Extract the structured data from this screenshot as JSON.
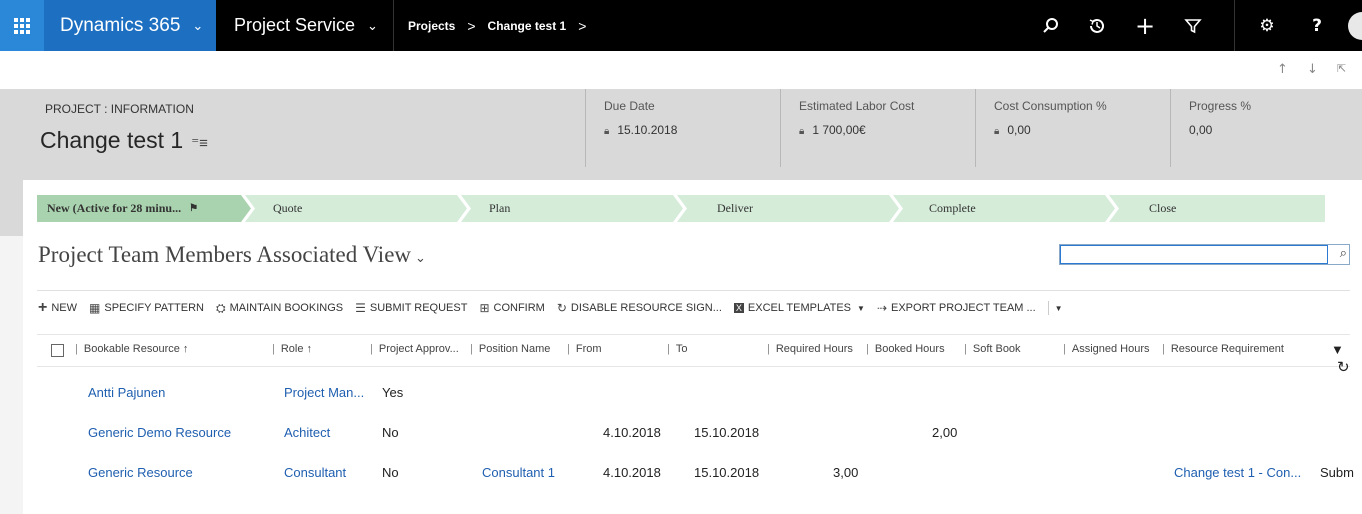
{
  "nav": {
    "app_name": "Dynamics 365",
    "area_name": "Project Service",
    "breadcrumbs": [
      "Projects",
      "Change test 1"
    ],
    "icons": [
      "search-icon",
      "history-icon",
      "add-icon",
      "filter-icon",
      "settings-icon",
      "help-icon"
    ]
  },
  "header": {
    "entity_label": "PROJECT : INFORMATION",
    "record_title": "Change test 1",
    "fields": [
      {
        "label": "Due Date",
        "value": "15.10.2018",
        "locked": true
      },
      {
        "label": "Estimated Labor Cost",
        "value": "1 700,00€",
        "locked": true
      },
      {
        "label": "Cost Consumption %",
        "value": "0,00",
        "locked": true
      },
      {
        "label": "Progress %",
        "value": "0,00",
        "locked": false
      }
    ]
  },
  "process": {
    "stages": [
      "New (Active for 28 minu...",
      "Quote",
      "Plan",
      "Deliver",
      "Complete",
      "Close"
    ],
    "active_color": "#a9d3ae",
    "stage_color": "#d5ecd9"
  },
  "view": {
    "title": "Project Team Members Associated View",
    "search_placeholder": ""
  },
  "commands": [
    {
      "label": "NEW",
      "icon": "+"
    },
    {
      "label": "SPECIFY PATTERN",
      "icon": "▦"
    },
    {
      "label": "MAINTAIN BOOKINGS",
      "icon": "⛭"
    },
    {
      "label": "SUBMIT REQUEST",
      "icon": "☰"
    },
    {
      "label": "CONFIRM",
      "icon": "⊞"
    },
    {
      "label": "DISABLE RESOURCE SIGN...",
      "icon": "↻"
    },
    {
      "label": "EXCEL TEMPLATES",
      "icon": "▣"
    },
    {
      "label": "EXPORT PROJECT TEAM ...",
      "icon": "⇢"
    }
  ],
  "columns": [
    "Bookable Resource ↑",
    "Role ↑",
    "Project Approv...",
    "Position Name",
    "From",
    "To",
    "Required Hours",
    "Booked Hours",
    "Soft Book",
    "Assigned Hours",
    "Resource Requirement"
  ],
  "rows": [
    {
      "resource": "Antti Pajunen",
      "role": "Project Man...",
      "approved": "Yes",
      "position": "",
      "from": "",
      "to": "",
      "required": "",
      "booked": "",
      "requirement": "",
      "extra": ""
    },
    {
      "resource": "Generic Demo Resource",
      "role": "Achitect",
      "approved": "No",
      "position": "",
      "from": "4.10.2018",
      "to": "15.10.2018",
      "required": "",
      "booked": "2,00",
      "requirement": "",
      "extra": ""
    },
    {
      "resource": "Generic Resource",
      "role": "Consultant",
      "approved": "No",
      "position": "Consultant 1",
      "from": "4.10.2018",
      "to": "15.10.2018",
      "required": "3,00",
      "booked": "",
      "requirement": "Change test 1 - Con...",
      "extra": "Subm"
    }
  ]
}
